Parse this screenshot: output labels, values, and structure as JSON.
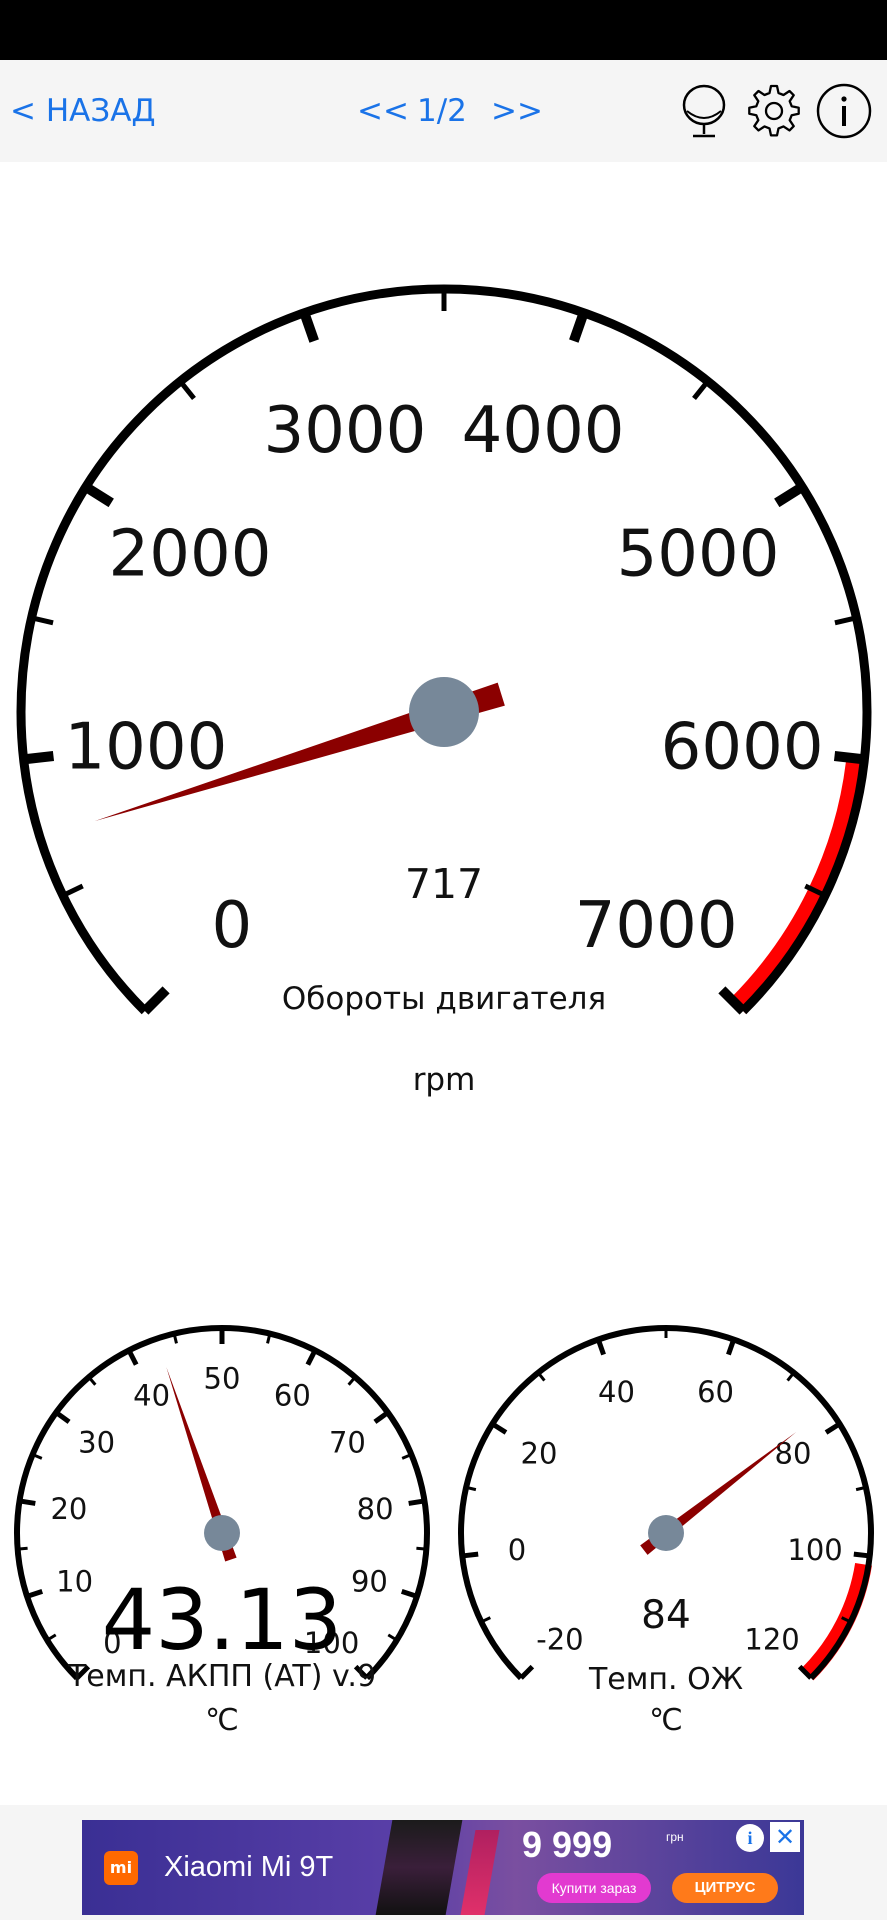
{
  "toolbar": {
    "back_label": "< НАЗАД",
    "prev_label": "<<",
    "page_indicator": "1/2",
    "next_label": ">>",
    "icons": [
      "voice-icon",
      "gear-icon",
      "info-icon"
    ],
    "accent_color": "#1a73e8"
  },
  "gauges": {
    "rpm": {
      "title": "Обороты двигателя",
      "unit": "rpm",
      "value": 717,
      "value_text": "717",
      "min": 0,
      "max": 7000,
      "tick_labels": [
        "0",
        "1000",
        "2000",
        "3000",
        "4000",
        "5000",
        "6000",
        "7000"
      ],
      "red_zone_start": 6000,
      "needle_color": "#8b0000",
      "red_zone_color": "#ff0000",
      "hub_color": "#778899"
    },
    "transmission_temp": {
      "title": "Темп. АКПП (AT) v.9",
      "unit": "℃",
      "value": 43.13,
      "value_text": "43.13",
      "min": 0,
      "max": 100,
      "tick_labels": [
        "0",
        "10",
        "20",
        "30",
        "40",
        "50",
        "60",
        "70",
        "80",
        "90",
        "100"
      ]
    },
    "coolant_temp": {
      "title": "Темп. ОЖ",
      "unit": "℃",
      "value": 84,
      "value_text": "84",
      "min": -20,
      "max": 130,
      "tick_labels": [
        "-20",
        "0",
        "20",
        "40",
        "60",
        "80",
        "100",
        "120"
      ],
      "red_zone_start": 110
    }
  },
  "ad": {
    "logo_text": "mi",
    "title": "Xiaomi Mi 9T",
    "price": "9 999",
    "price_currency": "грн",
    "cta": "Купити зараз",
    "store": "ЦИТРУС",
    "info_icon": "info-icon",
    "close_icon": "close-icon"
  }
}
